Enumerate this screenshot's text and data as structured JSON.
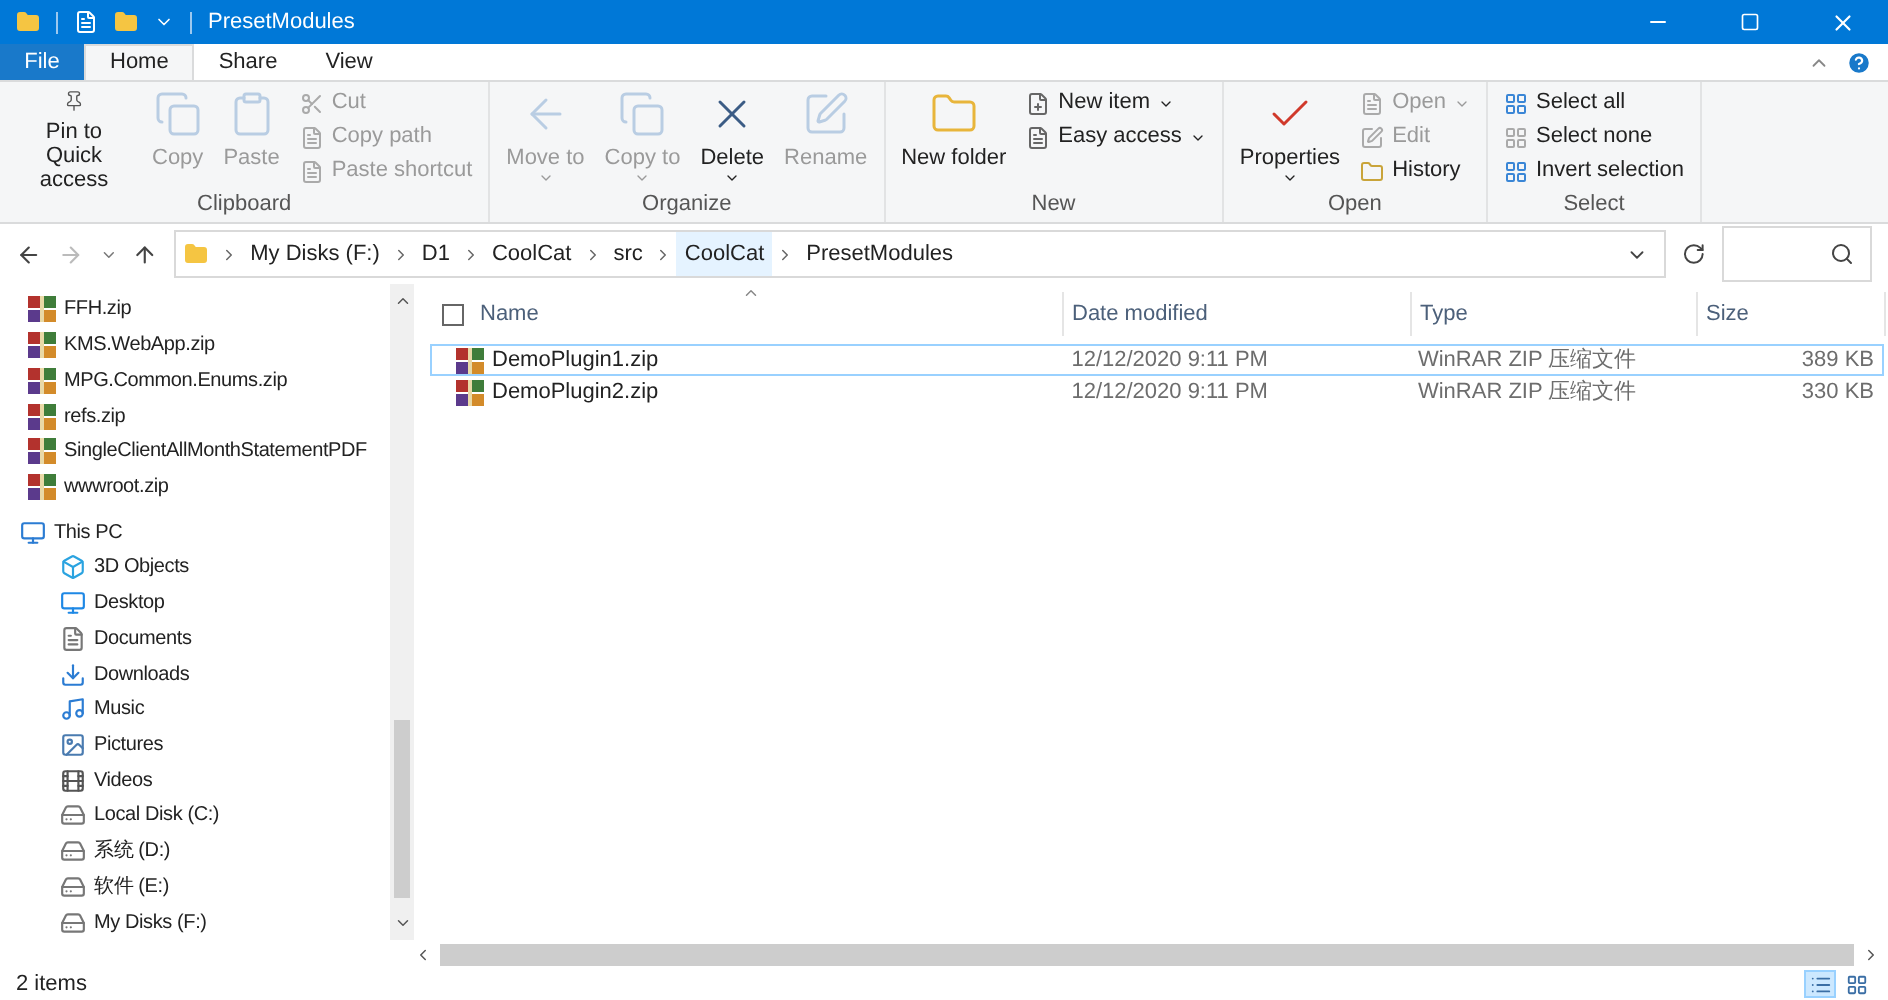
{
  "window": {
    "title": "PresetModules"
  },
  "tabs": [
    {
      "label": "File",
      "kind": "file",
      "selected": false
    },
    {
      "label": "Home",
      "kind": "tab",
      "selected": true
    },
    {
      "label": "Share",
      "kind": "tab",
      "selected": false
    },
    {
      "label": "View",
      "kind": "tab",
      "selected": false
    }
  ],
  "ribbon": [
    {
      "label": "Clipboard",
      "large": [
        {
          "label": "Pin to Quick access",
          "kind": "pin",
          "disabled": false,
          "dropdown": false
        },
        {
          "label": "Copy",
          "kind": "copy",
          "disabled": true,
          "dropdown": false
        },
        {
          "label": "Paste",
          "kind": "paste",
          "disabled": true,
          "dropdown": false
        }
      ],
      "small": [
        {
          "label": "Cut",
          "kind": "cut",
          "disabled": true,
          "dropdown": false
        },
        {
          "label": "Copy path",
          "kind": "path",
          "disabled": true,
          "dropdown": false
        },
        {
          "label": "Paste shortcut",
          "kind": "shortcut",
          "disabled": true,
          "dropdown": false
        }
      ]
    },
    {
      "label": "Organize",
      "large": [
        {
          "label": "Move to",
          "kind": "move",
          "disabled": true,
          "dropdown": true
        },
        {
          "label": "Copy to",
          "kind": "copyto",
          "disabled": true,
          "dropdown": true
        },
        {
          "label": "Delete",
          "kind": "delete",
          "disabled": false,
          "dropdown": true
        },
        {
          "label": "Rename",
          "kind": "rename",
          "disabled": true,
          "dropdown": false
        }
      ]
    },
    {
      "label": "New",
      "large": [
        {
          "label": "New folder",
          "kind": "folder",
          "disabled": false,
          "dropdown": false
        }
      ],
      "small": [
        {
          "label": "New item",
          "kind": "newitem",
          "disabled": false,
          "dropdown": true
        },
        {
          "label": "Easy access",
          "kind": "easy",
          "disabled": false,
          "dropdown": true
        }
      ]
    },
    {
      "label": "Open",
      "large": [
        {
          "label": "Properties",
          "kind": "properties",
          "disabled": false,
          "dropdown": true
        }
      ],
      "small": [
        {
          "label": "Open",
          "kind": "open",
          "disabled": true,
          "dropdown": true
        },
        {
          "label": "Edit",
          "kind": "edit",
          "disabled": true,
          "dropdown": false
        },
        {
          "label": "History",
          "kind": "history",
          "disabled": false,
          "dropdown": false
        }
      ]
    },
    {
      "label": "Select",
      "small": [
        {
          "label": "Select all",
          "kind": "selall",
          "disabled": false,
          "dropdown": false
        },
        {
          "label": "Select none",
          "kind": "selnone",
          "disabled": false,
          "dropdown": false
        },
        {
          "label": "Invert selection",
          "kind": "invert",
          "disabled": false,
          "dropdown": false
        }
      ]
    }
  ],
  "breadcrumb": [
    {
      "label": "My Disks (F:)",
      "highlighted": false
    },
    {
      "label": "D1",
      "highlighted": false
    },
    {
      "label": "CoolCat",
      "highlighted": false
    },
    {
      "label": "src",
      "highlighted": false
    },
    {
      "label": "CoolCat",
      "highlighted": true
    },
    {
      "label": "PresetModules",
      "highlighted": false
    }
  ],
  "sidebar": {
    "items": [
      {
        "label": "FFH.zip",
        "kind": "zip"
      },
      {
        "label": "KMS.WebApp.zip",
        "kind": "zip"
      },
      {
        "label": "MPG.Common.Enums.zip",
        "kind": "zip"
      },
      {
        "label": "refs.zip",
        "kind": "zip"
      },
      {
        "label": "SingleClientAllMonthStatementPDF",
        "kind": "zip"
      },
      {
        "label": "wwwroot.zip",
        "kind": "zip"
      },
      {
        "label": "This PC",
        "kind": "pc",
        "children": [
          {
            "label": "3D Objects",
            "kind": "objects3d"
          },
          {
            "label": "Desktop",
            "kind": "desktop"
          },
          {
            "label": "Documents",
            "kind": "documents"
          },
          {
            "label": "Downloads",
            "kind": "downloads"
          },
          {
            "label": "Music",
            "kind": "music"
          },
          {
            "label": "Pictures",
            "kind": "pictures"
          },
          {
            "label": "Videos",
            "kind": "videos"
          },
          {
            "label": "Local Disk (C:)",
            "kind": "drive"
          },
          {
            "label": "系统 (D:)",
            "kind": "drive"
          },
          {
            "label": "软件 (E:)",
            "kind": "drive"
          },
          {
            "label": "My Disks (F:)",
            "kind": "drive"
          }
        ]
      }
    ]
  },
  "table": {
    "select_all_checked": false,
    "columns": [
      "Name",
      "Date modified",
      "Type",
      "Size"
    ],
    "rows": [
      {
        "name": "DemoPlugin1.zip",
        "date": "12/12/2020 9:11 PM",
        "type": "WinRAR ZIP 压缩文件",
        "size": "389 KB",
        "focused": true
      },
      {
        "name": "DemoPlugin2.zip",
        "date": "12/12/2020 9:11 PM",
        "type": "WinRAR ZIP 压缩文件",
        "size": "330 KB",
        "focused": false
      }
    ]
  },
  "status_bar": {
    "count": "2 items",
    "views": [
      {
        "kind": "details",
        "selected": true
      },
      {
        "kind": "tiles",
        "selected": false
      }
    ]
  }
}
